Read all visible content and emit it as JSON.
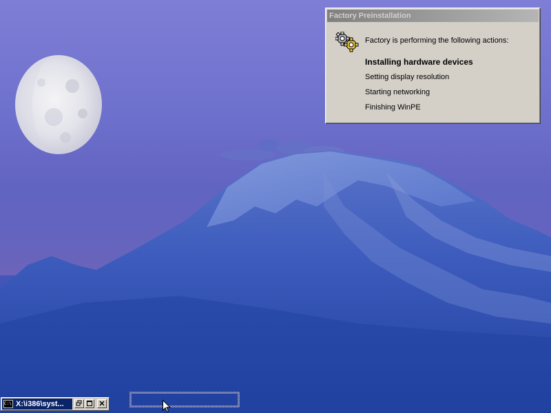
{
  "factory_window": {
    "title": "Factory Preinstallation",
    "intro": "Factory is performing the following actions:",
    "actions": [
      {
        "label": "Installing hardware devices",
        "state": "current"
      },
      {
        "label": "Setting display resolution",
        "state": "pending"
      },
      {
        "label": "Starting networking",
        "state": "pending"
      },
      {
        "label": "Finishing WinPE",
        "state": "pending"
      }
    ],
    "icon": "gears-icon"
  },
  "console_window": {
    "title": "X:\\i386\\syst...",
    "icon_label": "C:\\",
    "buttons": {
      "restore": "restore-icon",
      "maximize": "maximize-icon",
      "close": "close-icon"
    }
  },
  "colors": {
    "sky_top": "#7f7ed6",
    "sky_bottom": "#2444a6",
    "inactive_titlebar": "#808080",
    "active_titlebar": "#0a246a",
    "dialog_face": "#d4d0c8"
  }
}
